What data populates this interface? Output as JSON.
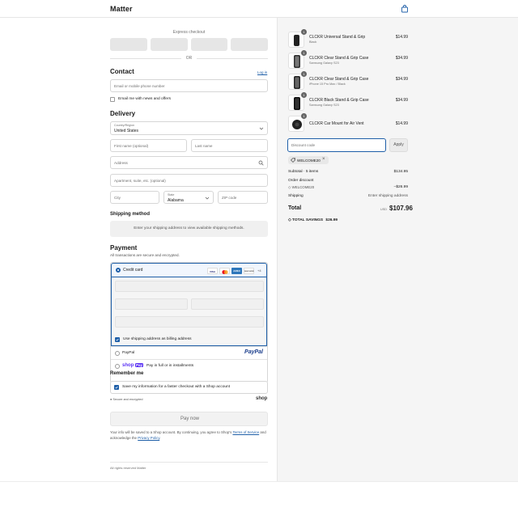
{
  "header": {
    "brand": "Matter",
    "cart_icon": "bag-icon"
  },
  "express": {
    "label": "Express checkout",
    "or": "OR"
  },
  "contact": {
    "title": "Contact",
    "login_link": "Log in",
    "email_placeholder": "Email or mobile phone number",
    "news_label": "Email me with news and offers"
  },
  "delivery": {
    "title": "Delivery",
    "country_label": "Country/Region",
    "country_value": "United States",
    "first_name_ph": "First name (optional)",
    "last_name_ph": "Last name",
    "address_ph": "Address",
    "apartment_ph": "Apartment, suite, etc. (optional)",
    "city_ph": "City",
    "state_label": "State",
    "state_value": "Alabama",
    "zip_ph": "ZIP code"
  },
  "shipping_method": {
    "title": "Shipping method",
    "info": "Enter your shipping address to view available shipping methods."
  },
  "payment": {
    "title": "Payment",
    "subtitle": "All transactions are secure and encrypted.",
    "credit_card_label": "Credit card",
    "card_logos": [
      "VISA",
      "MC",
      "AMEX",
      "DISCOVER"
    ],
    "card_more": "+4",
    "billing_same_label": "Use shipping address as billing address",
    "paypal_label": "PayPal",
    "paypal_logo": "PayPal",
    "shoppay_logo_a": "shop",
    "shoppay_logo_b": "Pay",
    "shoppay_text": "Pay in full or in installments"
  },
  "remember": {
    "title": "Remember me",
    "save_label": "Save my information for a faster checkout with a Shop account",
    "secure_text": "Secure and encrypted",
    "shop_logo": "shop"
  },
  "pay_now": "Pay now",
  "legal": {
    "text_a": "Your info will be saved to a Shop account. By continuing, you agree to Shop's ",
    "terms": "Terms of Service",
    "text_b": " and acknowledge the ",
    "privacy": "Privacy Policy",
    "text_c": "."
  },
  "footer": "All rights reserved Matter",
  "order": {
    "items": [
      {
        "qty": "1",
        "name": "CLCKR Universal Stand & Grip",
        "variant": "Black",
        "price": "$14.99"
      },
      {
        "qty": "1",
        "name": "CLCKR Clear Stand & Grip Case",
        "variant": "Samsung Galaxy S23",
        "price": "$34.99"
      },
      {
        "qty": "1",
        "name": "CLCKR Clear Stand & Grip Case",
        "variant": "iPhone 15 Pro Max / Black",
        "price": "$34.99"
      },
      {
        "qty": "1",
        "name": "CLCKR Black Stand & Grip Case",
        "variant": "Samsung Galaxy S23",
        "price": "$34.99"
      },
      {
        "qty": "1",
        "name": "CLCKR Car Mount for Air Vent",
        "variant": "",
        "price": "$14.99"
      }
    ],
    "discount_ph": "Discount code",
    "apply": "Apply",
    "applied_code": "WELCOME20",
    "subtotal_label": "Subtotal · 5 items",
    "subtotal_value": "$134.95",
    "order_discount_label": "Order discount",
    "discount_code": "WELCOME20",
    "discount_value": "–$26.99",
    "shipping_label": "Shipping",
    "shipping_value": "Enter shipping address",
    "total_label": "Total",
    "currency": "USD",
    "total_value": "$107.96",
    "savings_label": "TOTAL SAVINGS",
    "savings_value": "$26.99"
  },
  "colors": {
    "accent": "#1f5fa8",
    "panel": "#f5f5f5"
  }
}
